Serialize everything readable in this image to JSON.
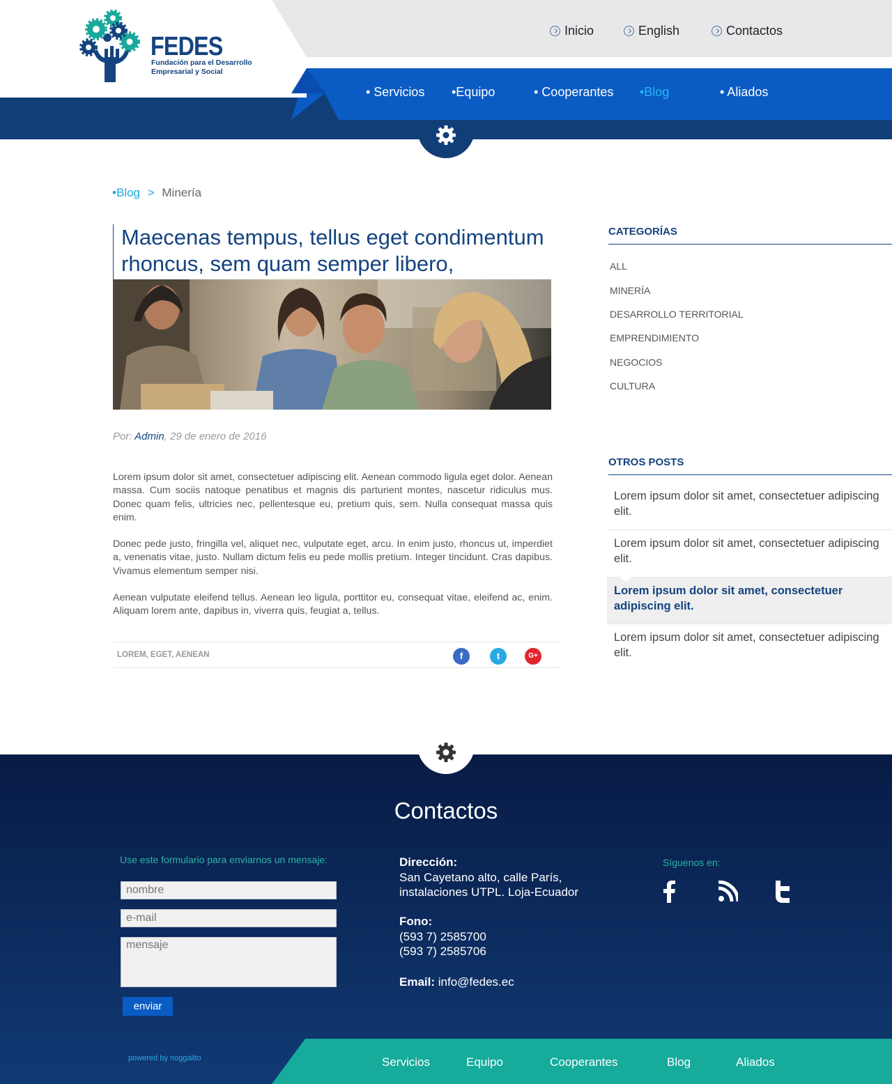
{
  "brand": {
    "name": "FEDES",
    "tagline": "Fundación para el Desarrollo Empresarial y Social",
    "colors": {
      "primary": "#14437f",
      "accent_blue": "#0a5bc4",
      "teal": "#16ab9a",
      "cyan": "#24b6f0"
    }
  },
  "top_nav": [
    {
      "label": "Inicio",
      "icon": "chevron-circle-icon"
    },
    {
      "label": "English",
      "icon": "chevron-circle-icon"
    },
    {
      "label": "Contactos",
      "icon": "chevron-circle-icon"
    }
  ],
  "main_nav": [
    {
      "label": "• Servicios",
      "active": false
    },
    {
      "label": "•Equipo",
      "active": false
    },
    {
      "label": "• Cooperantes",
      "active": false
    },
    {
      "label": "•Blog",
      "active": true
    },
    {
      "label": "• Aliados",
      "active": false
    }
  ],
  "breadcrumb": {
    "parent": "•Blog",
    "separator": ">",
    "current": "Minería"
  },
  "post": {
    "title": "Maecenas tempus, tellus eget condimentum rhoncus, sem quam semper libero,",
    "byline_prefix": "Por:",
    "author": "Admin",
    "date": ", 29 de enero de 2016",
    "paragraphs": [
      "Lorem ipsum dolor sit amet, consectetuer adipiscing elit. Aenean commodo ligula eget dolor. Aenean massa. Cum sociis natoque penatibus et magnis dis parturient montes, nascetur ridiculus mus. Donec quam felis, ultricies nec, pellentesque eu, pretium quis, sem. Nulla consequat massa quis enim.",
      "Donec pede justo, fringilla vel, aliquet nec, vulputate eget, arcu. In enim justo, rhoncus ut, imperdiet a, venenatis vitae, justo. Nullam dictum felis eu pede mollis pretium. Integer tincidunt. Cras dapibus. Vivamus elementum semper nisi.",
      "Aenean vulputate eleifend tellus. Aenean leo ligula, porttitor eu, consequat vitae, eleifend ac, enim. Aliquam lorem ante, dapibus in, viverra quis, feugiat a, tellus."
    ],
    "tags": "LOREM, EGET, AENEAN",
    "share": [
      {
        "icon": "facebook-icon",
        "glyph": "f",
        "color": "#3b6cc4"
      },
      {
        "icon": "twitter-icon",
        "glyph": "t",
        "color": "#29a9e1"
      },
      {
        "icon": "google-plus-icon",
        "glyph": "G+",
        "color": "#e0262c"
      }
    ]
  },
  "sidebar": {
    "categories_title": "CATEGORÍAS",
    "categories": [
      "ALL",
      "MINERÍA",
      "DESARROLLO TERRITORIAL",
      "EMPRENDIMIENTO",
      "NEGOCIOS",
      "CULTURA"
    ],
    "other_posts_title": "OTROS POSTS",
    "other_posts": [
      {
        "text": "Lorem ipsum dolor sit amet, consectetuer adipiscing elit.",
        "active": false
      },
      {
        "text": "Lorem ipsum dolor sit amet, consectetuer adipiscing elit.",
        "active": false
      },
      {
        "text": "Lorem ipsum dolor sit amet, consectetuer adipiscing elit.",
        "active": true
      },
      {
        "text": "Lorem ipsum dolor sit amet, consectetuer adipiscing elit.",
        "active": false
      }
    ]
  },
  "footer": {
    "title": "Contactos",
    "form_intro": "Use este formulario para enviarnos un mensaje:",
    "name_placeholder": "nombre",
    "email_placeholder": "e-mail",
    "message_placeholder": "mensaje",
    "send_label": "enviar",
    "address_label": "Dirección:",
    "address_line1": "San Cayetano alto, calle París,",
    "address_line2": "instalaciones UTPL. Loja-Ecuador",
    "phone_label": "Fono:",
    "phone1": "(593 7) 2585700",
    "phone2": "(593 7) 2585706",
    "email_label": "Email:",
    "email": "info@fedes.ec",
    "follow_label": "Síguenos en:",
    "social": [
      "facebook-icon",
      "rss-icon",
      "twitter-icon"
    ],
    "powered": "powered by noggalito",
    "nav": [
      "Servicios",
      "Equipo",
      "Cooperantes",
      "Blog",
      "Aliados"
    ]
  }
}
